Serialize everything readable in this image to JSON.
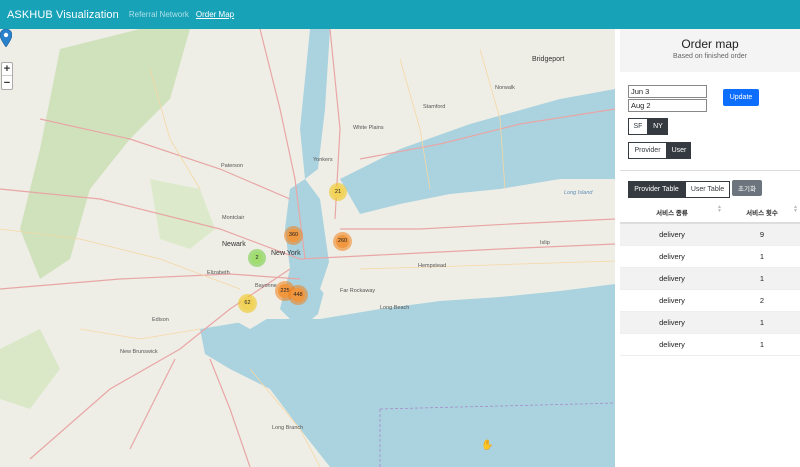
{
  "navbar": {
    "brand": "ASKHUB Visualization",
    "links": [
      {
        "label": "Referral Network",
        "active": false
      },
      {
        "label": "Order Map",
        "active": true
      }
    ]
  },
  "map": {
    "zoom_in": "+",
    "zoom_out": "−",
    "clusters": [
      {
        "label": "21",
        "color": "yellow"
      },
      {
        "label": "360",
        "color": "orange"
      },
      {
        "label": "260",
        "color": "orange"
      },
      {
        "label": "2",
        "color": "green"
      },
      {
        "label": "225",
        "color": "orange"
      },
      {
        "label": "448",
        "color": "orange"
      },
      {
        "label": "62",
        "color": "yellow"
      }
    ],
    "place_labels": {
      "new_york": "New York",
      "newark": "Newark",
      "paterson": "Paterson",
      "yonkers": "Yonkers",
      "stamford": "Stamford",
      "bridgeport": "Bridgeport",
      "long_island": "Long Island",
      "long_branch": "Long Branch",
      "new_brunswick": "New Brunswick",
      "elizabeth": "Elizabeth",
      "edison": "Edison",
      "islip": "Islip",
      "hempstead": "Hempstead",
      "long_beach": "Long Beach",
      "montclair": "Montclair",
      "norwalk": "Norwalk",
      "white_plains": "White Plains",
      "bayonne": "Bayonne",
      "rockaway": "Far Rockaway"
    },
    "pin_icon": "map-marker-icon"
  },
  "panel": {
    "title": "Order map",
    "subtitle": "Based on finished order",
    "start_date": "Jun 3",
    "end_date": "Aug 2",
    "update_label": "Update",
    "city_toggle": [
      {
        "label": "SF",
        "selected": false
      },
      {
        "label": "NY",
        "selected": true
      }
    ],
    "role_toggle": [
      {
        "label": "Provider",
        "selected": false
      },
      {
        "label": "User",
        "selected": true
      }
    ],
    "table_tabs": [
      {
        "label": "Provider Table",
        "selected": true
      },
      {
        "label": "User Table",
        "selected": false
      }
    ],
    "reset_label": "초기화",
    "table": {
      "headers": [
        "서비스 종류",
        "서비스 횟수"
      ],
      "rows": [
        [
          "delivery",
          "9"
        ],
        [
          "delivery",
          "1"
        ],
        [
          "delivery",
          "1"
        ],
        [
          "delivery",
          "2"
        ],
        [
          "delivery",
          "1"
        ],
        [
          "delivery",
          "1"
        ]
      ]
    }
  }
}
